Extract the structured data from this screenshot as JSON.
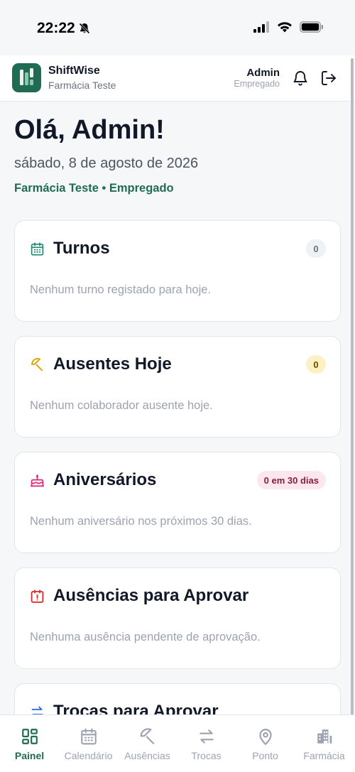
{
  "status_bar": {
    "time": "22:22"
  },
  "header": {
    "app_name": "ShiftWise",
    "pharmacy": "Farmácia Teste",
    "user_name": "Admin",
    "user_role": "Empregado"
  },
  "greeting": {
    "title": "Olá, Admin!",
    "date": "sábado, 8 de agosto de 2026",
    "context": "Farmácia Teste • Empregado"
  },
  "cards": [
    {
      "icon": "calendar-icon",
      "title": "Turnos",
      "badge": "0",
      "empty_text": "Nenhum turno registado para hoje.",
      "color": "#1f8a6f"
    },
    {
      "icon": "umbrella-icon",
      "title": "Ausentes Hoje",
      "badge": "0",
      "empty_text": "Nenhum colaborador ausente hoje.",
      "color": "#e0a100"
    },
    {
      "icon": "cake-icon",
      "title": "Aniversários",
      "badge": "0 em 30 dias",
      "empty_text": "Nenhum aniversário nos próximos 30 dias.",
      "color": "#db2777"
    },
    {
      "icon": "alert-calendar-icon",
      "title": "Ausências para Aprovar",
      "badge": "",
      "empty_text": "Nenhuma ausência pendente de aprovação.",
      "color": "#dc2626"
    },
    {
      "icon": "swap-icon",
      "title": "Trocas para Aprovar",
      "badge": "",
      "empty_text": "",
      "color": "#2563eb"
    }
  ],
  "nav": [
    {
      "label": "Painel",
      "icon": "dashboard-icon",
      "active": true
    },
    {
      "label": "Calendário",
      "icon": "calendar-icon",
      "active": false
    },
    {
      "label": "Ausências",
      "icon": "umbrella-icon",
      "active": false
    },
    {
      "label": "Trocas",
      "icon": "swap-icon",
      "active": false
    },
    {
      "label": "Ponto",
      "icon": "location-pin-icon",
      "active": false
    },
    {
      "label": "Farmácia",
      "icon": "building-icon",
      "active": false
    }
  ],
  "colors": {
    "brand": "#1f6b53",
    "text": "#111827",
    "muted": "#9ca3af"
  }
}
